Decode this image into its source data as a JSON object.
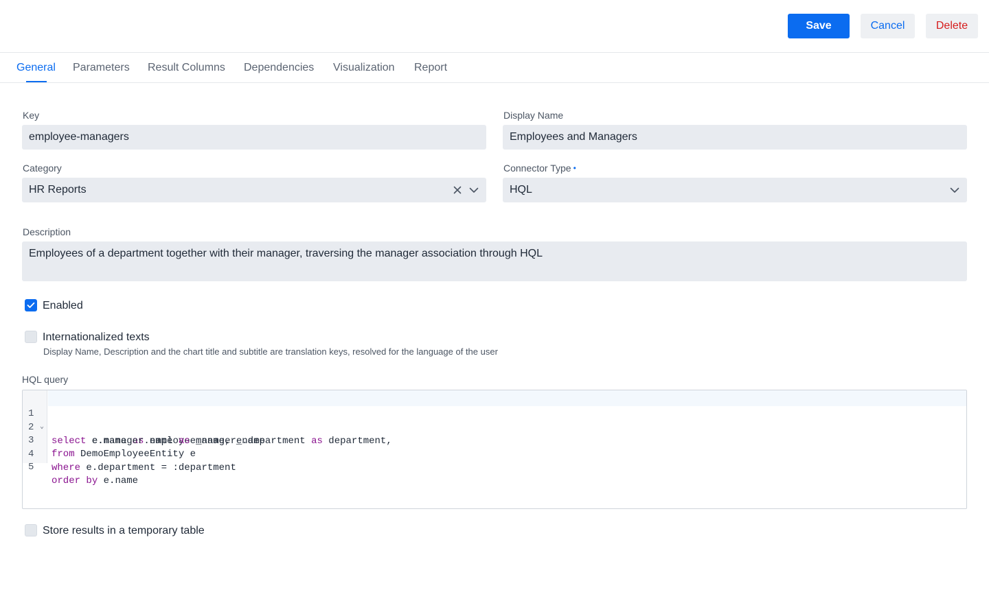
{
  "toolbar": {
    "save_label": "Save",
    "cancel_label": "Cancel",
    "delete_label": "Delete"
  },
  "tabs": [
    {
      "label": "General",
      "active": true
    },
    {
      "label": "Parameters",
      "active": false
    },
    {
      "label": "Result Columns",
      "active": false
    },
    {
      "label": "Dependencies",
      "active": false
    },
    {
      "label": "Visualization",
      "active": false
    },
    {
      "label": "Report",
      "active": false
    }
  ],
  "form": {
    "key": {
      "label": "Key",
      "value": "employee-managers"
    },
    "display_name": {
      "label": "Display Name",
      "value": "Employees and Managers"
    },
    "category": {
      "label": "Category",
      "value": "HR Reports"
    },
    "connector_type": {
      "label": "Connector Type",
      "required_marker": "•",
      "value": "HQL"
    },
    "description": {
      "label": "Description",
      "value": "Employees of a department together with their manager, traversing the manager association through HQL"
    },
    "enabled": {
      "label": "Enabled",
      "checked": true
    },
    "i18n": {
      "label": "Internationalized texts",
      "checked": false,
      "hint": "Display Name, Description and the chart title and subtitle are translation keys, resolved for the language of the user"
    },
    "hql": {
      "label": "HQL query",
      "line_numbers": [
        "1",
        "2",
        "3",
        "4",
        "5"
      ]
    },
    "temp_table": {
      "label": "Store results in a temporary table",
      "checked": false
    }
  },
  "colors": {
    "accent": "#0b6cf0",
    "danger": "#d61c1c",
    "keyword": "#8a138f"
  }
}
